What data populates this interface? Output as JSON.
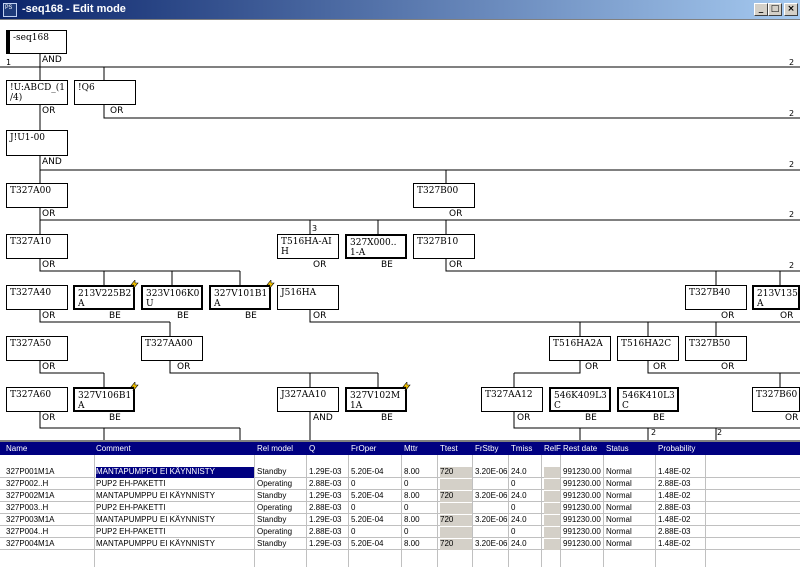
{
  "window": {
    "title": "-seq168  - Edit mode",
    "icon_label": "PS",
    "minimize_glyph": "_",
    "maximize_glyph": "□",
    "close_glyph": "×"
  },
  "tree": {
    "nodes": [
      {
        "id": "seq168",
        "label": "-seq168",
        "type": "gate"
      },
      {
        "id": "uabcd",
        "label": "!U:ABCD_(1\n/4)",
        "type": "gate"
      },
      {
        "id": "q6",
        "label": "!Q6",
        "type": "gate"
      },
      {
        "id": "ju1",
        "label": "J!U1-00",
        "type": "gate"
      },
      {
        "id": "t327a00",
        "label": "T327A00",
        "type": "gate"
      },
      {
        "id": "t327b00",
        "label": "T327B00",
        "type": "gate"
      },
      {
        "id": "t327a10",
        "label": "T327A10",
        "type": "gate"
      },
      {
        "id": "t516ha",
        "label": "T516HA-AI\nH",
        "type": "gate"
      },
      {
        "id": "x000",
        "label": "327X000..\n1-A",
        "type": "be"
      },
      {
        "id": "t327b10",
        "label": "T327B10",
        "type": "gate"
      },
      {
        "id": "t327a40",
        "label": "T327A40",
        "type": "gate"
      },
      {
        "id": "v225",
        "label": "213V225B2\nA",
        "type": "be"
      },
      {
        "id": "v106k",
        "label": "323V106K0\nU",
        "type": "be"
      },
      {
        "id": "v101",
        "label": "327V101B1\nA",
        "type": "be"
      },
      {
        "id": "j516",
        "label": "J516HA",
        "type": "gate"
      },
      {
        "id": "t327b40",
        "label": "T327B40",
        "type": "gate"
      },
      {
        "id": "v135",
        "label": "213V135\nA",
        "type": "be"
      },
      {
        "id": "t327a50",
        "label": "T327A50",
        "type": "gate"
      },
      {
        "id": "t327aa00",
        "label": "T327AA00",
        "type": "gate"
      },
      {
        "id": "t516a",
        "label": "T516HA2A",
        "type": "gate"
      },
      {
        "id": "t516c",
        "label": "T516HA2C",
        "type": "gate"
      },
      {
        "id": "t327b50",
        "label": "T327B50",
        "type": "gate"
      },
      {
        "id": "t327a60",
        "label": "T327A60",
        "type": "gate"
      },
      {
        "id": "v106b",
        "label": "327V106B1\nA",
        "type": "be"
      },
      {
        "id": "j327aa10",
        "label": "J327AA10",
        "type": "gate"
      },
      {
        "id": "v102",
        "label": "327V102M\n1A",
        "type": "be"
      },
      {
        "id": "t327aa12",
        "label": "T327AA12",
        "type": "gate"
      },
      {
        "id": "k409",
        "label": "546K409L3\nC",
        "type": "be"
      },
      {
        "id": "k410",
        "label": "546K410L3\nC",
        "type": "be"
      },
      {
        "id": "t327b60",
        "label": "T327B60",
        "type": "gate"
      }
    ],
    "gates": [
      {
        "label": "AND"
      },
      {
        "label": "OR"
      },
      {
        "label": "OR"
      },
      {
        "label": "AND"
      },
      {
        "label": "OR"
      },
      {
        "label": "OR"
      },
      {
        "label": "OR"
      },
      {
        "label": "OR"
      },
      {
        "label": "BE"
      },
      {
        "label": "OR"
      },
      {
        "label": "OR"
      },
      {
        "label": "BE"
      },
      {
        "label": "BE"
      },
      {
        "label": "BE"
      },
      {
        "label": "OR"
      },
      {
        "label": "OR"
      },
      {
        "label": "OR"
      },
      {
        "label": "OR"
      },
      {
        "label": "OR"
      },
      {
        "label": "OR"
      },
      {
        "label": "OR"
      },
      {
        "label": "OR"
      },
      {
        "label": "OR"
      },
      {
        "label": "BE"
      },
      {
        "label": "AND"
      },
      {
        "label": "BE"
      },
      {
        "label": "OR"
      },
      {
        "label": "BE"
      },
      {
        "label": "BE"
      },
      {
        "label": "OR"
      }
    ],
    "numbers": [
      "1",
      "2",
      "2",
      "2",
      "2",
      "3",
      "2",
      "2",
      "2",
      "2",
      "2",
      "2",
      "2"
    ]
  },
  "grid": {
    "columns": [
      "Name",
      "Comment",
      "Rel model",
      "Q",
      "FrOper",
      "Mttr",
      "Ttest",
      "FrStby",
      "Tmiss",
      "RelF",
      "Rest date",
      "Status",
      "Probability"
    ],
    "rows": [
      [
        "327P001M1A",
        "MANTAPUMPPU EI   KÄYNNISTY",
        "Standby",
        "1.29E-03",
        "5.20E-04",
        "8.00",
        "720",
        "3.20E-06",
        "24.0",
        "",
        "991230.00",
        "Normal",
        "1.48E-02"
      ],
      [
        "327P002..H",
        "PUP2 EH-PAKETTI",
        "Operating",
        "2.88E-03",
        "0",
        "0",
        "",
        "",
        "0",
        "",
        "991230.00",
        "Normal",
        "2.88E-03"
      ],
      [
        "327P002M1A",
        "MANTAPUMPPU    EI KÄYNNISTY",
        "Standby",
        "1.29E-03",
        "5.20E-04",
        "8.00",
        "720",
        "3.20E-06",
        "24.0",
        "",
        "991230.00",
        "Normal",
        "1.48E-02"
      ],
      [
        "327P003..H",
        "PUP2 EH-PAKETTI",
        "Operating",
        "2.88E-03",
        "0",
        "0",
        "",
        "",
        "0",
        "",
        "991230.00",
        "Normal",
        "2.88E-03"
      ],
      [
        "327P003M1A",
        "MANTAPUMPPU    EI KÄYNNISTY",
        "Standby",
        "1.29E-03",
        "5.20E-04",
        "8.00",
        "720",
        "3.20E-06",
        "24.0",
        "",
        "991230.00",
        "Normal",
        "1.48E-02"
      ],
      [
        "327P004..H",
        "PUP2 EH-PAKETTI",
        "Operating",
        "2.88E-03",
        "0",
        "0",
        "",
        "",
        "0",
        "",
        "991230.00",
        "Normal",
        "2.88E-03"
      ],
      [
        "327P004M1A",
        "MANTAPUMPPU    EI KÄYNNISTY",
        "Standby",
        "1.29E-03",
        "5.20E-04",
        "8.00",
        "720",
        "3.20E-06",
        "24.0",
        "",
        "991230.00",
        "Normal",
        "1.48E-02"
      ]
    ]
  }
}
